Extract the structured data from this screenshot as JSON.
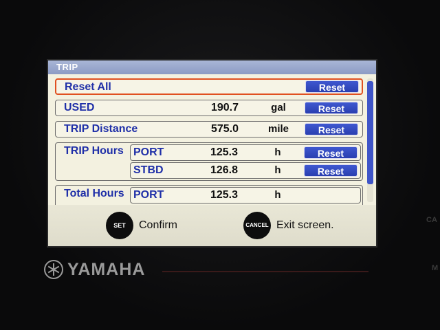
{
  "screen": {
    "title": "TRIP",
    "rows": {
      "reset_all": {
        "label": "Reset All",
        "button": "Reset"
      },
      "used": {
        "label": "USED",
        "value": "190.7",
        "unit": "gal",
        "button": "Reset"
      },
      "trip_distance": {
        "label": "TRIP Distance",
        "value": "575.0",
        "unit": "mile",
        "button": "Reset"
      },
      "trip_hours": {
        "label": "TRIP Hours",
        "port": {
          "label": "PORT",
          "value": "125.3",
          "unit": "h",
          "button": "Reset"
        },
        "stbd": {
          "label": "STBD",
          "value": "126.8",
          "unit": "h",
          "button": "Reset"
        }
      },
      "total_hours": {
        "label": "Total Hours",
        "port": {
          "label": "PORT",
          "value": "125.3",
          "unit": "h"
        }
      }
    },
    "footer": {
      "set_button": "SET",
      "set_label": "Confirm",
      "cancel_button": "CANCEL",
      "cancel_label": "Exit screen."
    }
  },
  "device": {
    "brand": "YAMAHA",
    "side_label_top": "CA",
    "side_label_bottom": "M"
  },
  "colors": {
    "title_bar": "#8c9bc4",
    "label_blue": "#1f2fa8",
    "button_blue": "#2a3fb0",
    "selected_border": "#e05020",
    "screen_bg": "#f3f1e0"
  }
}
